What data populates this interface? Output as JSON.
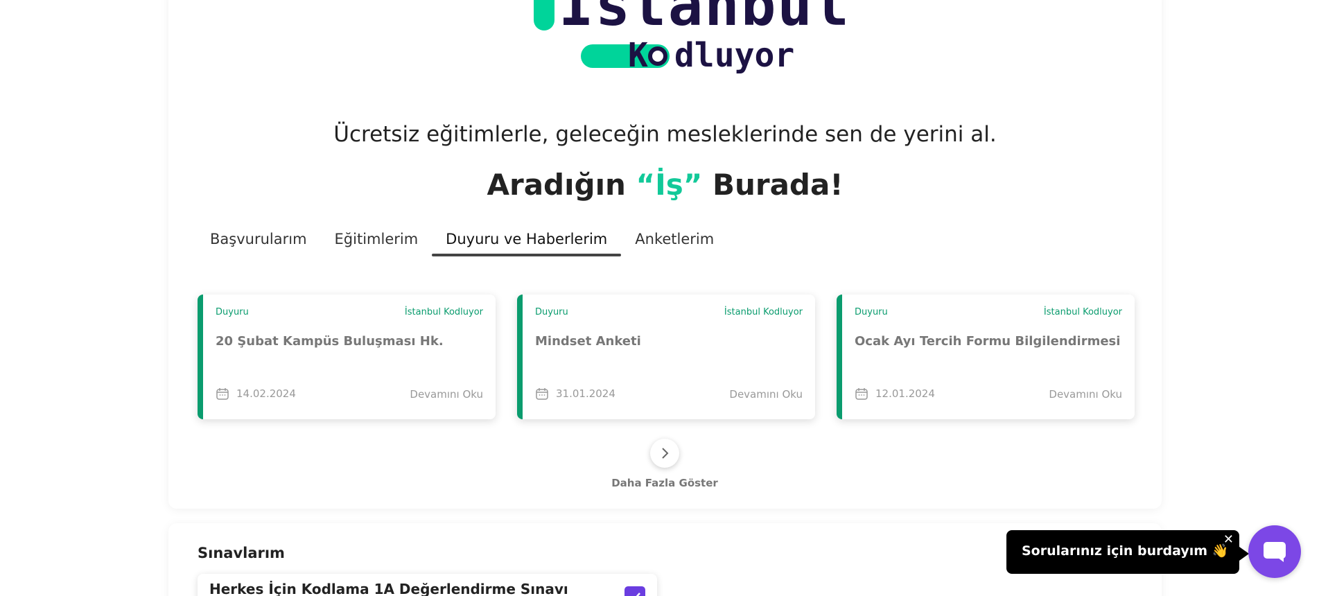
{
  "logo": {
    "big_text": "İstanbul",
    "small_k": "K",
    "small_rest": "dluyor"
  },
  "tagline": "Ücretsiz eğitimlerle, geleceğin mesleklerinde sen de yerini al.",
  "headline": {
    "before": "Aradığın",
    "highlight": "“İş”",
    "after": "Burada!"
  },
  "tabs": [
    {
      "label": "Başvurularım",
      "active": false
    },
    {
      "label": "Eğitimlerim",
      "active": false
    },
    {
      "label": "Duyuru ve Haberlerim",
      "active": true
    },
    {
      "label": "Anketlerim",
      "active": false
    }
  ],
  "cards": [
    {
      "category": "Duyuru",
      "source": "İstanbul Kodluyor",
      "title": "20 Şubat Kampüs Buluşması Hk.",
      "date": "14.02.2024",
      "more": "Devamını Oku"
    },
    {
      "category": "Duyuru",
      "source": "İstanbul Kodluyor",
      "title": "Mindset Anketi",
      "date": "31.01.2024",
      "more": "Devamını Oku"
    },
    {
      "category": "Duyuru",
      "source": "İstanbul Kodluyor",
      "title": "Ocak Ayı Tercih Formu Bilgilendirmesi",
      "date": "12.01.2024",
      "more": "Devamını Oku"
    }
  ],
  "show_more_label": "Daha Fazla Göster",
  "exams": {
    "title": "Sınavlarım",
    "items": [
      {
        "name": "Herkes İçin Kodlama 1A Değerlendirme Sınavı"
      }
    ]
  },
  "chat": {
    "message": "Sorularınız için burdayım 👋",
    "close": "✕"
  },
  "colors": {
    "accent_green": "#0a9c6e",
    "logo_green": "#00d49a",
    "logo_navy": "#1c1243",
    "chat_purple": "#7c47e6"
  }
}
